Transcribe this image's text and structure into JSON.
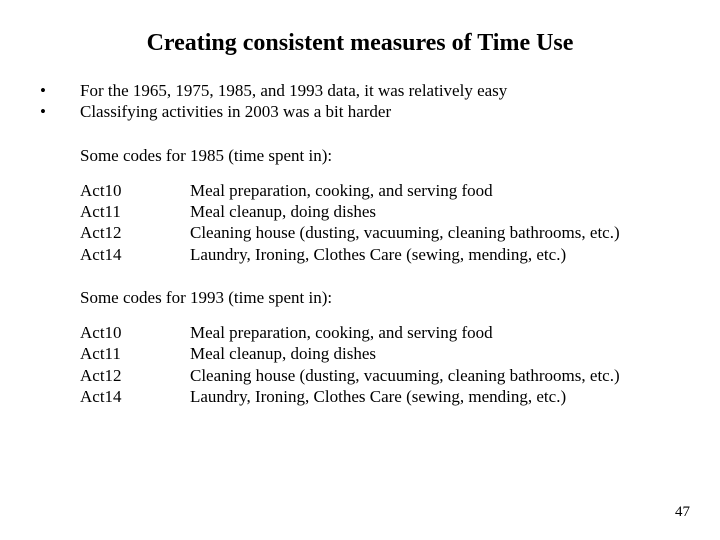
{
  "title": "Creating consistent measures of Time Use",
  "bullets": [
    "For the 1965, 1975, 1985, and 1993 data, it was relatively easy",
    "Classifying activities in 2003 was a bit harder"
  ],
  "bullet_mark": "•",
  "section1_label": "Some codes for 1985 (time spent in):",
  "section1_codes": [
    {
      "code": "Act10",
      "desc": "Meal preparation, cooking, and serving food"
    },
    {
      "code": "Act11",
      "desc": "Meal cleanup, doing dishes"
    },
    {
      "code": "Act12",
      "desc": "Cleaning house (dusting, vacuuming, cleaning bathrooms, etc.)"
    },
    {
      "code": "Act14",
      "desc": "Laundry, Ironing, Clothes Care (sewing, mending, etc.)"
    }
  ],
  "section2_label": "Some codes for 1993 (time spent in):",
  "section2_codes": [
    {
      "code": "Act10",
      "desc": "Meal preparation, cooking, and serving food"
    },
    {
      "code": "Act11",
      "desc": "Meal cleanup, doing dishes"
    },
    {
      "code": "Act12",
      "desc": "Cleaning house (dusting, vacuuming, cleaning bathrooms, etc.)"
    },
    {
      "code": "Act14",
      "desc": "Laundry, Ironing, Clothes Care (sewing, mending, etc.)"
    }
  ],
  "page_number": "47"
}
